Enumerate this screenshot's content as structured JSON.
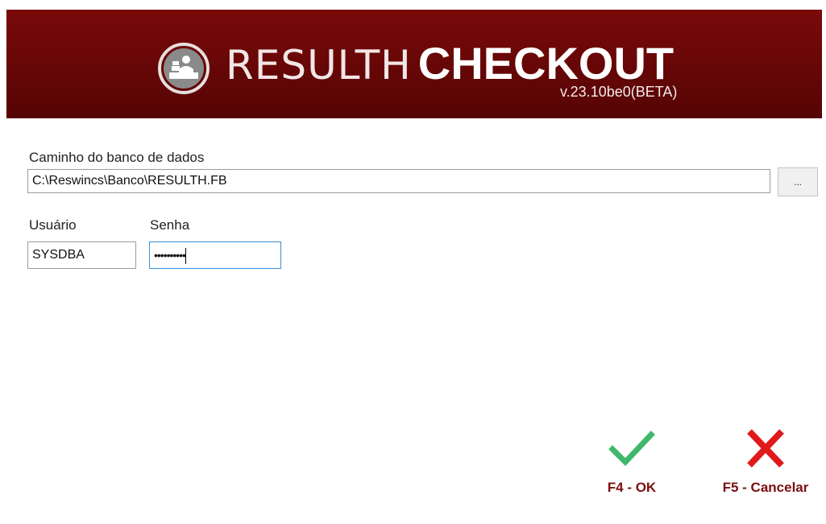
{
  "header": {
    "title_light": "RESULTH",
    "title_bold": "CHECKOUT",
    "version": "v.23.10be0(BETA)",
    "logo_icon": "cashier-icon",
    "background_color": "#6b0808"
  },
  "form": {
    "db_path_label": "Caminho do banco de dados",
    "db_path_value": "C:\\Reswincs\\Banco\\RESULTH.FB",
    "browse_label": "...",
    "user_label": "Usuário",
    "user_value": "SYSDBA",
    "password_label": "Senha",
    "password_value": "••••••••••",
    "focus_color": "#3a8fd6"
  },
  "actions": {
    "ok": {
      "label": "F4 - OK",
      "icon": "checkmark-icon",
      "color": "#3fb86b"
    },
    "cancel": {
      "label": "F5 - Cancelar",
      "icon": "close-icon",
      "color": "#e01a1a"
    }
  }
}
